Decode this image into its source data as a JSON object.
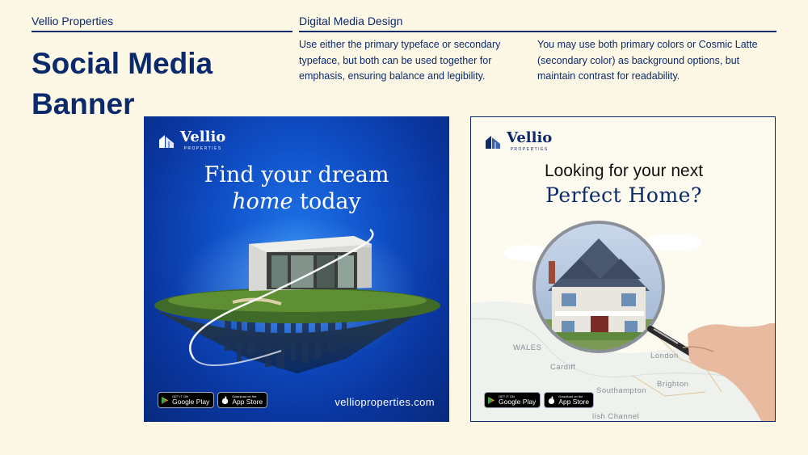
{
  "header": {
    "brand": "Vellio Properties",
    "section": "Digital Media Design"
  },
  "title": "Social Media Banner",
  "paragraphs": {
    "p1": "Use either the primary typeface or secondary typeface, but both can be used together for emphasis, ensuring balance and legibility.",
    "p2": "You may use both primary colors or Cosmic Latte (secondary color) as background options, but maintain contrast for readability."
  },
  "banner1": {
    "logo_name": "Vellio",
    "logo_sub": "PROPERTIES",
    "headline_line1": "Find your dream",
    "headline_italic": "home",
    "headline_rest": " today",
    "url": "vellioproperties.com",
    "google_small": "GET IT ON",
    "google_big": "Google Play",
    "apple_small": "Download on the",
    "apple_big": "App Store"
  },
  "banner2": {
    "logo_name": "Vellio",
    "logo_sub": "PROPERTIES",
    "question_line1": "Looking for your next",
    "question_line2": "Perfect Home?",
    "map_labels": [
      "WALES",
      "Cardiff",
      "London",
      "Brighton",
      "Southampton",
      "lish Channel"
    ],
    "google_small": "GET IT ON",
    "google_big": "Google Play",
    "apple_small": "Download on the",
    "apple_big": "App Store"
  },
  "colors": {
    "navy": "#0b2a6b",
    "cosmic_latte": "#fdf7e6",
    "banner_blue": "#0f4fc7"
  }
}
